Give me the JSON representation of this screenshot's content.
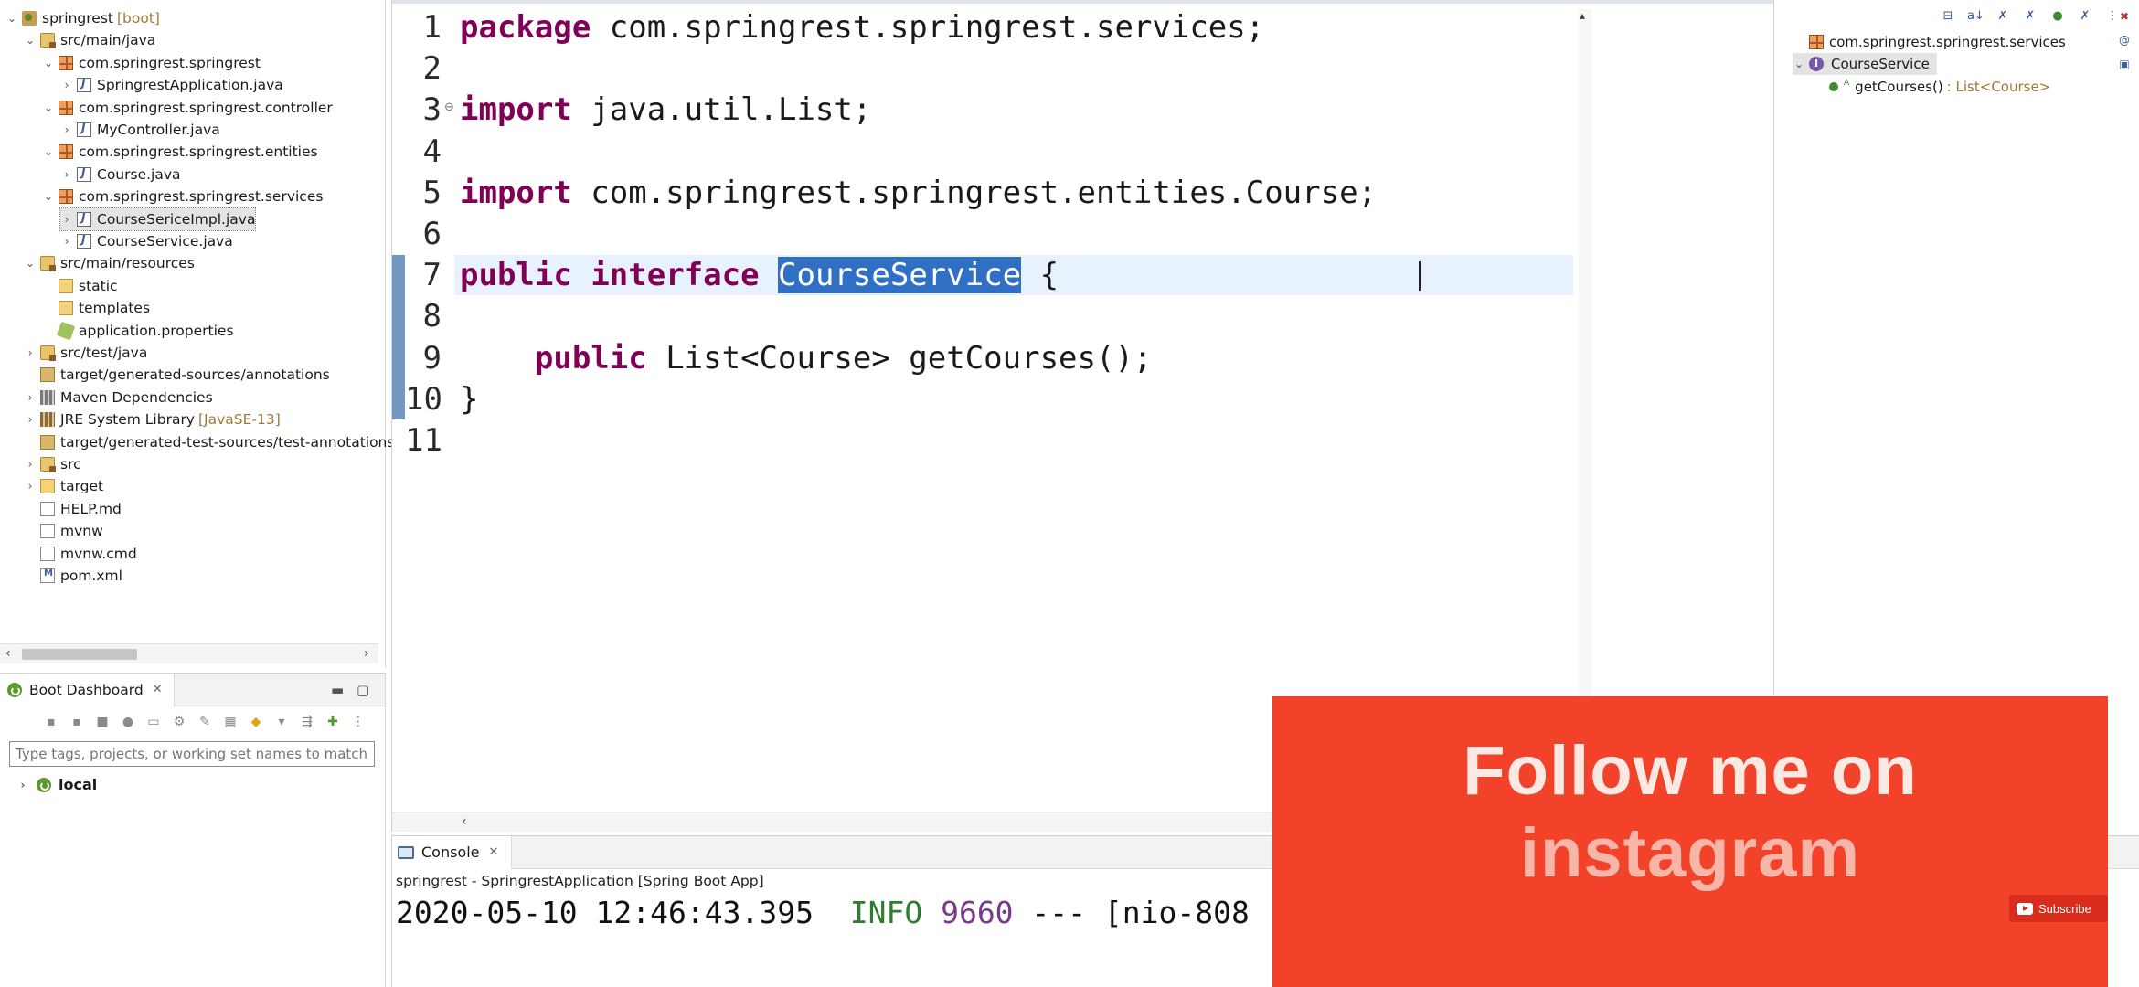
{
  "explorer": {
    "items": [
      {
        "label": "springrest",
        "suffix": "[boot]",
        "depth": 0,
        "chevron": "v",
        "icon": "ic-project",
        "icon_name": "spring-project-icon"
      },
      {
        "label": "src/main/java",
        "depth": 1,
        "chevron": "v",
        "icon": "ic-srcfolder",
        "icon_name": "source-folder-icon"
      },
      {
        "label": "com.springrest.springrest",
        "depth": 2,
        "chevron": "v",
        "icon": "ic-package",
        "icon_name": "package-icon"
      },
      {
        "label": "SpringrestApplication.java",
        "depth": 3,
        "chevron": ">",
        "icon": "ic-java",
        "icon_name": "java-file-icon"
      },
      {
        "label": "com.springrest.springrest.controller",
        "depth": 2,
        "chevron": "v",
        "icon": "ic-package",
        "icon_name": "package-icon"
      },
      {
        "label": "MyController.java",
        "depth": 3,
        "chevron": ">",
        "icon": "ic-java",
        "icon_name": "java-file-icon"
      },
      {
        "label": "com.springrest.springrest.entities",
        "depth": 2,
        "chevron": "v",
        "icon": "ic-package",
        "icon_name": "package-icon"
      },
      {
        "label": "Course.java",
        "depth": 3,
        "chevron": ">",
        "icon": "ic-java",
        "icon_name": "java-file-icon"
      },
      {
        "label": "com.springrest.springrest.services",
        "depth": 2,
        "chevron": "v",
        "icon": "ic-package",
        "icon_name": "package-icon"
      },
      {
        "label": "CourseSericeImpl.java",
        "depth": 3,
        "chevron": ">",
        "icon": "ic-java",
        "icon_name": "java-file-icon",
        "selected": true
      },
      {
        "label": "CourseService.java",
        "depth": 3,
        "chevron": ">",
        "icon": "ic-java",
        "icon_name": "java-file-icon"
      },
      {
        "label": "src/main/resources",
        "depth": 1,
        "chevron": "v",
        "icon": "ic-srcfolder",
        "icon_name": "source-folder-icon"
      },
      {
        "label": "static",
        "depth": 2,
        "chevron": "",
        "icon": "ic-folder",
        "icon_name": "folder-icon"
      },
      {
        "label": "templates",
        "depth": 2,
        "chevron": "",
        "icon": "ic-folder",
        "icon_name": "folder-icon"
      },
      {
        "label": "application.properties",
        "depth": 2,
        "chevron": "",
        "icon": "ic-props",
        "icon_name": "properties-file-icon"
      },
      {
        "label": "src/test/java",
        "depth": 1,
        "chevron": ">",
        "icon": "ic-srcfolder",
        "icon_name": "source-folder-icon"
      },
      {
        "label": "target/generated-sources/annotations",
        "depth": 1,
        "chevron": "",
        "icon": "ic-genfolder",
        "icon_name": "generated-folder-icon"
      },
      {
        "label": "Maven Dependencies",
        "depth": 1,
        "chevron": ">",
        "icon": "ic-lib",
        "icon_name": "library-icon"
      },
      {
        "label": "JRE System Library",
        "suffix": "[JavaSE-13]",
        "depth": 1,
        "chevron": ">",
        "icon": "ic-jre",
        "icon_name": "jre-library-icon"
      },
      {
        "label": "target/generated-test-sources/test-annotations",
        "depth": 1,
        "chevron": "",
        "icon": "ic-genfolder",
        "icon_name": "generated-folder-icon"
      },
      {
        "label": "src",
        "depth": 1,
        "chevron": ">",
        "icon": "ic-srcfolder",
        "icon_name": "folder-icon"
      },
      {
        "label": "target",
        "depth": 1,
        "chevron": ">",
        "icon": "ic-folder",
        "icon_name": "folder-icon"
      },
      {
        "label": "HELP.md",
        "depth": 1,
        "chevron": "",
        "icon": "ic-file",
        "icon_name": "text-file-icon"
      },
      {
        "label": "mvnw",
        "depth": 1,
        "chevron": "",
        "icon": "ic-file",
        "icon_name": "text-file-icon"
      },
      {
        "label": "mvnw.cmd",
        "depth": 1,
        "chevron": "",
        "icon": "ic-file",
        "icon_name": "text-file-icon"
      },
      {
        "label": "pom.xml",
        "depth": 1,
        "chevron": "",
        "icon": "ic-xml",
        "icon_name": "maven-pom-icon"
      }
    ]
  },
  "boot_dashboard": {
    "title": "Boot Dashboard",
    "filter_placeholder": "Type tags, projects, or working set names to match (inc",
    "local_label": "local"
  },
  "editor": {
    "line_numbers": [
      "1",
      "2",
      "3",
      "4",
      "5",
      "6",
      "7",
      "8",
      "9",
      "10",
      "11"
    ],
    "lines": [
      [
        {
          "t": "package",
          "k": true
        },
        {
          "t": " com.springrest.springrest.services;"
        }
      ],
      [],
      [
        {
          "t": "import",
          "k": true
        },
        {
          "t": " java.util.List;"
        }
      ],
      [],
      [
        {
          "t": "import",
          "k": true
        },
        {
          "t": " com.springrest.springrest.entities.Course;"
        }
      ],
      [],
      [
        {
          "t": "public",
          "k": true
        },
        {
          "t": " "
        },
        {
          "t": "interface",
          "k": true
        },
        {
          "t": " "
        },
        {
          "t": "CourseService",
          "sel": true
        },
        {
          "t": " {"
        }
      ],
      [],
      [
        {
          "t": "    "
        },
        {
          "t": "public",
          "k": true
        },
        {
          "t": " List<Course> getCourses();"
        }
      ],
      [
        {
          "t": "}"
        }
      ],
      []
    ]
  },
  "outline": {
    "package_label": "com.springrest.springrest.services",
    "interface_label": "CourseService",
    "method_label": "getCourses()",
    "method_return": ": List<Course>"
  },
  "console": {
    "tab_label": "Console",
    "subtitle": "springrest - SpringrestApplication [Spring Boot App]",
    "log_time": "2020-05-10 12:46:43.395",
    "log_level": "INFO",
    "log_pid": "9660",
    "log_rest": " --- [nio-808"
  },
  "overlay": {
    "line1": "Follow me on",
    "line2": "instagram",
    "subscribe": "Subscribe"
  }
}
